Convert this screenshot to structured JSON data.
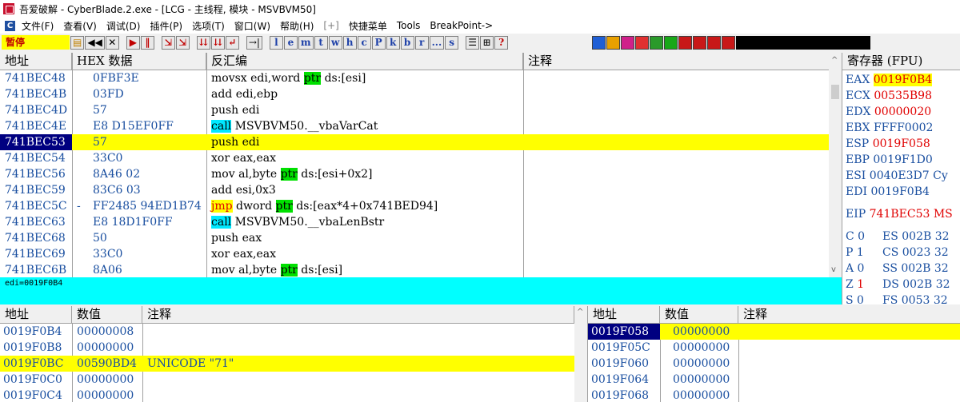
{
  "titlebar": {
    "text": "吾爱破解 - CyberBlade.2.exe - [LCG - 主线程, 模块 - MSVBVM50]"
  },
  "menu": [
    "文件(F)",
    "查看(V)",
    "调试(D)",
    "插件(P)",
    "选项(T)",
    "窗口(W)",
    "帮助(H)",
    "[+]",
    "快捷菜单",
    "Tools",
    "BreakPoint->"
  ],
  "toolbar": {
    "status": "暂停",
    "nav_buttons": [
      "⏮",
      "◀◀",
      "✕",
      "▶",
      "‖",
      "⇲",
      "⇲",
      "⇊",
      "⇊",
      "↵",
      "→|"
    ],
    "letter_buttons": [
      "l",
      "e",
      "m",
      "t",
      "w",
      "h",
      "c",
      "P",
      "k",
      "b",
      "r",
      "...",
      "s"
    ],
    "misc_buttons": [
      "☰",
      "⊞",
      "?"
    ],
    "plugin_colors": [
      "#1f5fd6",
      "#e8a000",
      "#d0208a",
      "#e03030",
      "#2a9a2a",
      "#18a818",
      "#c81818",
      "#c81818",
      "#c81818",
      "#c81818"
    ]
  },
  "disasm": {
    "headers": {
      "address": "地址",
      "hex": "HEX 数据",
      "disasm": "反汇编",
      "comment": "注释"
    },
    "rows": [
      {
        "addr": "741BEC48",
        "hex": "0FBF3E",
        "parts": [
          {
            "t": "movsx edi,word "
          },
          {
            "t": "ptr",
            "c": "grn"
          },
          {
            "t": " ds:[esi]"
          }
        ]
      },
      {
        "addr": "741BEC4B",
        "hex": "03FD",
        "parts": [
          {
            "t": "add edi,ebp"
          }
        ]
      },
      {
        "addr": "741BEC4D",
        "hex": "57",
        "parts": [
          {
            "t": "push edi"
          }
        ]
      },
      {
        "addr": "741BEC4E",
        "hex": "E8 D15EF0FF",
        "parts": [
          {
            "t": "call",
            "c": "cyn"
          },
          {
            "t": " MSVBVM50.__vbaVarCat"
          }
        ]
      },
      {
        "addr": "741BEC53",
        "hex": "57",
        "parts": [
          {
            "t": "push edi"
          }
        ],
        "current": true
      },
      {
        "addr": "741BEC54",
        "hex": "33C0",
        "parts": [
          {
            "t": "xor eax,eax"
          }
        ]
      },
      {
        "addr": "741BEC56",
        "hex": "8A46 02",
        "parts": [
          {
            "t": "mov al,byte "
          },
          {
            "t": "ptr",
            "c": "grn"
          },
          {
            "t": " ds:[esi+0x2]"
          }
        ]
      },
      {
        "addr": "741BEC59",
        "hex": "83C6 03",
        "parts": [
          {
            "t": "add esi,0x3"
          }
        ]
      },
      {
        "addr": "741BEC5C",
        "mark": "-",
        "hex": "FF2485 94ED1B74",
        "parts": [
          {
            "t": "jmp",
            "c": "orn"
          },
          {
            "t": " dword "
          },
          {
            "t": "ptr",
            "c": "grn"
          },
          {
            "t": " ds:[eax*4+0x741BED94]"
          }
        ]
      },
      {
        "addr": "741BEC63",
        "hex": "E8 18D1F0FF",
        "parts": [
          {
            "t": "call",
            "c": "cyn"
          },
          {
            "t": " MSVBVM50.__vbaLenBstr"
          }
        ]
      },
      {
        "addr": "741BEC68",
        "hex": "50",
        "parts": [
          {
            "t": "push eax"
          }
        ]
      },
      {
        "addr": "741BEC69",
        "hex": "33C0",
        "parts": [
          {
            "t": "xor eax,eax"
          }
        ]
      },
      {
        "addr": "741BEC6B",
        "hex": "8A06",
        "parts": [
          {
            "t": "mov al,byte "
          },
          {
            "t": "ptr",
            "c": "grn"
          },
          {
            "t": " ds:[esi]"
          }
        ]
      }
    ]
  },
  "infoline": "edi=0019F0B4",
  "registers": {
    "header": "寄存器 (FPU)",
    "rows": [
      {
        "name": "EAX",
        "value": "0019F0B4",
        "changed": true,
        "hl": true
      },
      {
        "name": "ECX",
        "value": "00535B98",
        "changed": true
      },
      {
        "name": "EDX",
        "value": "00000020",
        "changed": true
      },
      {
        "name": "EBX",
        "value": "FFFF0002",
        "changed": false
      },
      {
        "name": "ESP",
        "value": "0019F058",
        "changed": true
      },
      {
        "name": "EBP",
        "value": "0019F1D0",
        "changed": false
      },
      {
        "name": "ESI",
        "value": "0040E3D7 Cy",
        "changed": false
      },
      {
        "name": "EDI",
        "value": "0019F0B4",
        "changed": false
      },
      {
        "name": "EIP",
        "value": "741BEC53 MS",
        "changed": true,
        "gap": true
      },
      {
        "flag": "C 0",
        "seg": "ES 002B 32",
        "gap": true
      },
      {
        "flag": "P 1",
        "seg": "CS 0023 32"
      },
      {
        "flag": "A 0",
        "seg": "SS 002B 32"
      },
      {
        "flag": "Z 1",
        "seg": "DS 002B 32",
        "zred": true
      },
      {
        "flag": "S 0",
        "seg": "FS 0053 32"
      }
    ]
  },
  "dump": {
    "headers": {
      "address": "地址",
      "value": "数值",
      "comment": "注释"
    },
    "rows": [
      {
        "addr": "0019F0B4",
        "value": "00000008",
        "comment": ""
      },
      {
        "addr": "0019F0B8",
        "value": "00000000",
        "comment": ""
      },
      {
        "addr": "0019F0BC",
        "value": "00590BD4",
        "comment": "UNICODE \"71\"",
        "hl": true
      },
      {
        "addr": "0019F0C0",
        "value": "00000000",
        "comment": ""
      },
      {
        "addr": "0019F0C4",
        "value": "00000000",
        "comment": ""
      }
    ]
  },
  "stack": {
    "headers": {
      "address": "地址",
      "value": "数值",
      "comment": "注释"
    },
    "rows": [
      {
        "addr": "0019F058",
        "value": "00000000",
        "selected": true
      },
      {
        "addr": "0019F05C",
        "value": "00000000"
      },
      {
        "addr": "0019F060",
        "value": "00000000"
      },
      {
        "addr": "0019F064",
        "value": "00000000"
      },
      {
        "addr": "0019F068",
        "value": "00000000"
      }
    ]
  }
}
